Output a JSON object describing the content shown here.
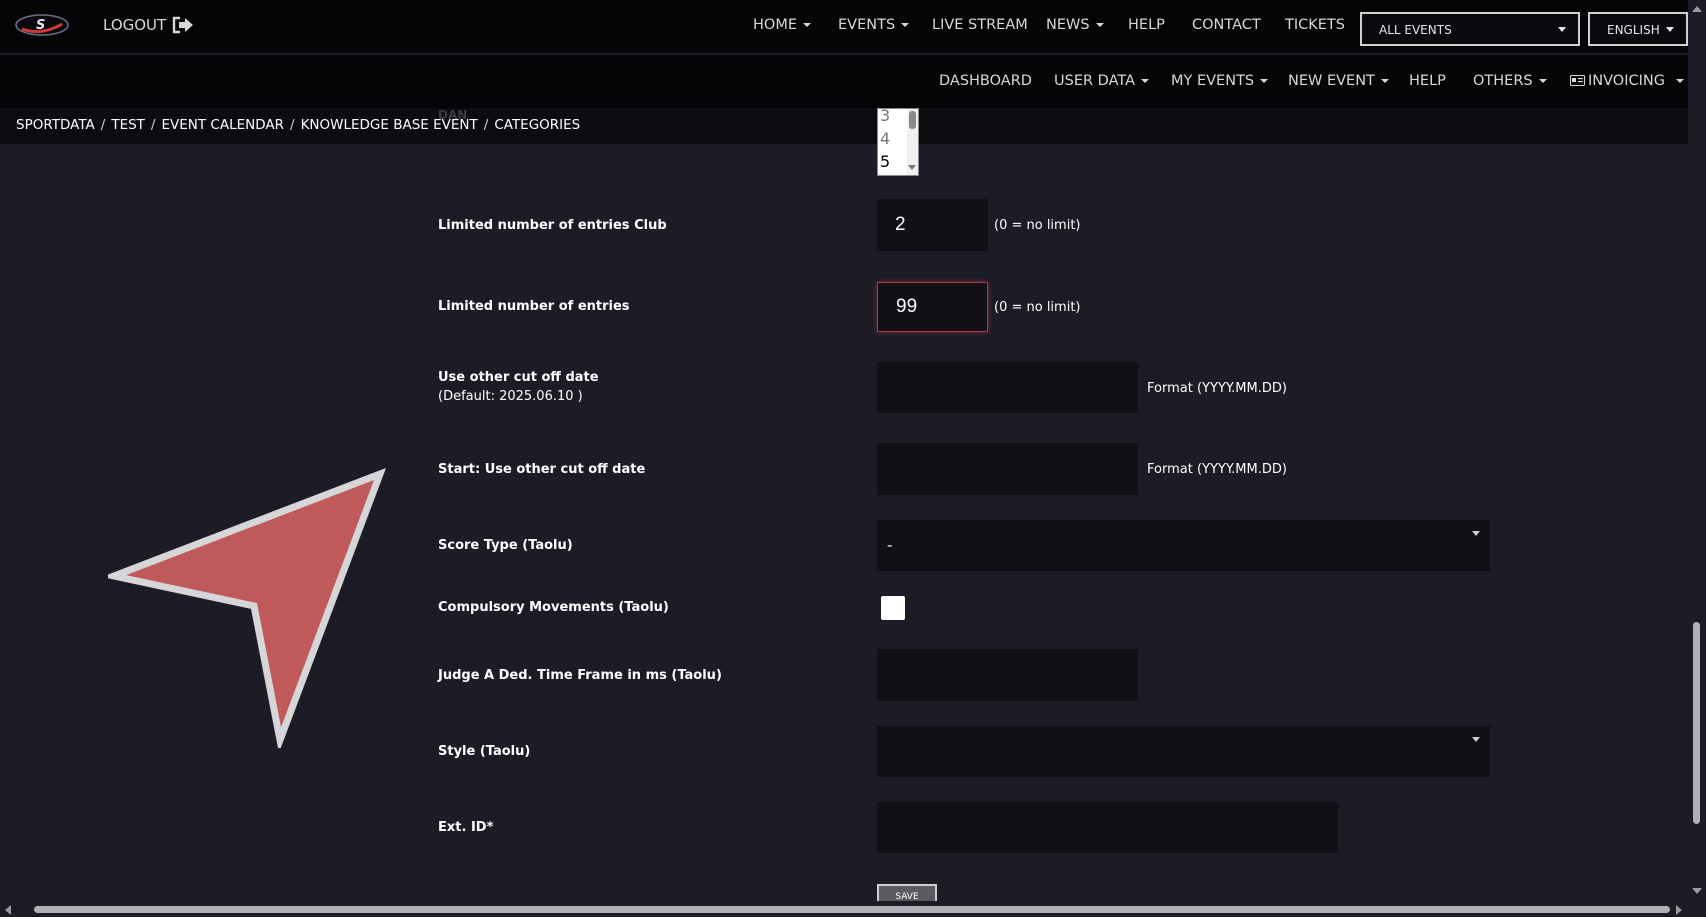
{
  "header": {
    "logout_label": "LOGOUT",
    "nav": [
      "HOME",
      "EVENTS",
      "LIVE STREAM",
      "NEWS",
      "HELP",
      "CONTACT",
      "TICKETS"
    ],
    "event_select": "ALL EVENTS",
    "language_select": "ENGLISH"
  },
  "secondary_nav": [
    "DASHBOARD",
    "USER DATA",
    "MY EVENTS",
    "NEW EVENT",
    "HELP",
    "OTHERS",
    "INVOICING"
  ],
  "breadcrumb": [
    "SPORTDATA",
    "TEST",
    "EVENT CALENDAR",
    "KNOWLEDGE BASE EVENT",
    "CATEGORIES"
  ],
  "form": {
    "dan_label": "DAN",
    "dan_options": [
      "3",
      "4",
      "5"
    ],
    "club_limit_label": "Limited number of entries Club",
    "club_limit_value": "2",
    "limit_hint": "(0 = no limit)",
    "entries_limit_label": "Limited number of entries",
    "entries_limit_value": "99",
    "cutoff_label": "Use other cut off date",
    "cutoff_default": "(Default: 2025.06.10 )",
    "date_format_hint": "Format (YYYY.MM.DD)",
    "start_cutoff_label": "Start: Use other cut off date",
    "score_type_label": "Score Type (Taolu)",
    "score_type_value": "-",
    "compulsory_label": "Compulsory Movements (Taolu)",
    "judge_label": "Judge A Ded. Time Frame in ms (Taolu)",
    "style_label": "Style (Taolu)",
    "ext_id_label": "Ext. ID*",
    "save_label": "SAVE"
  },
  "colors": {
    "page_bg": "#1c1c26",
    "header_bg": "#050507",
    "input_bg": "#101016",
    "focus_border": "#b33a4a",
    "pointer_fill": "#c0595a"
  }
}
